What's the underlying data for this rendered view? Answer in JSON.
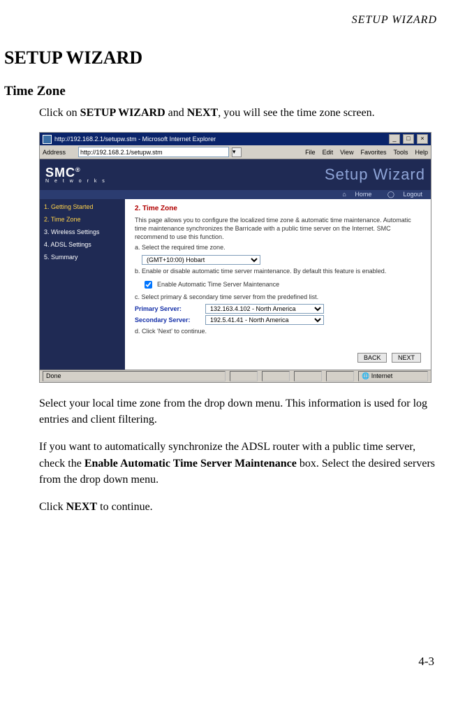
{
  "running_head": "SETUP WIZARD",
  "h1": "SETUP WIZARD",
  "h2": "Time Zone",
  "intro": {
    "pre": "Click on ",
    "b1": "SETUP WIZARD",
    "mid": " and ",
    "b2": "NEXT",
    "post": ", you will see the time zone screen."
  },
  "para2": "Select your local time zone from the drop down menu. This information is used for log entries and client filtering.",
  "para3": {
    "pre": "If you want to automatically synchronize the ADSL router with a public time server, check the ",
    "b": "Enable Automatic Time Server Maintenance",
    "post": " box.  Select the desired servers from the drop down menu."
  },
  "para4": {
    "pre": "Click ",
    "b": "NEXT",
    "post": " to continue."
  },
  "page_number": "4-3",
  "ie": {
    "title": "http://192.168.2.1/setupw.stm - Microsoft Internet Explorer",
    "address_label": "Address",
    "address_value": "http://192.168.2.1/setupw.stm",
    "menu": [
      "File",
      "Edit",
      "View",
      "Favorites",
      "Tools",
      "Help"
    ],
    "win_min": "_",
    "win_max": "□",
    "win_close": "×",
    "status_left": "Done",
    "status_right": "Internet"
  },
  "brand": {
    "logo": "SMC",
    "reg": "®",
    "sub": "N e t w o r k s",
    "wizard": "Setup Wizard"
  },
  "util": {
    "home": "Home",
    "logout": "Logout",
    "home_icon": "⌂",
    "logout_icon": "◯"
  },
  "sidebar": {
    "items": [
      "1. Getting Started",
      "2. Time Zone",
      "3. Wireless Settings",
      "4. ADSL Settings",
      "5. Summary"
    ]
  },
  "wiz": {
    "section_title": "2. Time Zone",
    "intro": "This page allows you to configure the localized time zone & automatic time maintenance. Automatic time maintenance synchronizes the Barricade with a public time server on the Internet. SMC recommend to use this function.",
    "step_a": "a. Select the required time zone.",
    "tz_value": "(GMT+10:00) Hobart",
    "step_b": "b. Enable or disable automatic time server maintenance. By default this feature is enabled.",
    "chk_label": "Enable Automatic Time Server Maintenance",
    "step_c": "c. Select primary & secondary time server from the predefined list.",
    "primary_label": "Primary Server:",
    "primary_value": "132.163.4.102 - North America",
    "secondary_label": "Secondary Server:",
    "secondary_value": "192.5.41.41 - North America",
    "step_d": "d. Click 'Next' to continue.",
    "back": "BACK",
    "next": "NEXT"
  }
}
